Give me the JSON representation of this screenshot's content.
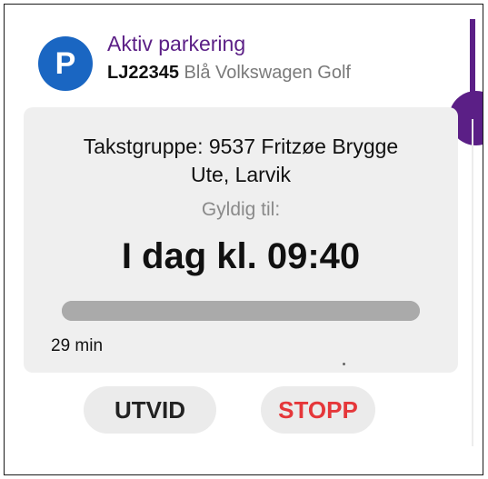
{
  "header": {
    "icon_letter": "P",
    "title": "Aktiv parkering",
    "plate": "LJ22345",
    "vehicle": "Blå Volkswagen Golf"
  },
  "card": {
    "zone_line1": "Takstgruppe: 9537 Fritzøe Brygge",
    "zone_line2": "Ute, Larvik",
    "valid_label": "Gyldig til:",
    "valid_time": "I dag kl. 09:40",
    "progress_fraction": 1.0,
    "remaining": "29 min"
  },
  "actions": {
    "extend_label": "UTVID",
    "stop_label": "STOPP"
  },
  "colors": {
    "accent": "#5b1f86",
    "parking_icon": "#1a66c2",
    "stop": "#e5373a",
    "card_bg": "#efefef",
    "progress": "#aaaaaa"
  },
  "icons": {
    "parking": "parking-p-icon"
  }
}
